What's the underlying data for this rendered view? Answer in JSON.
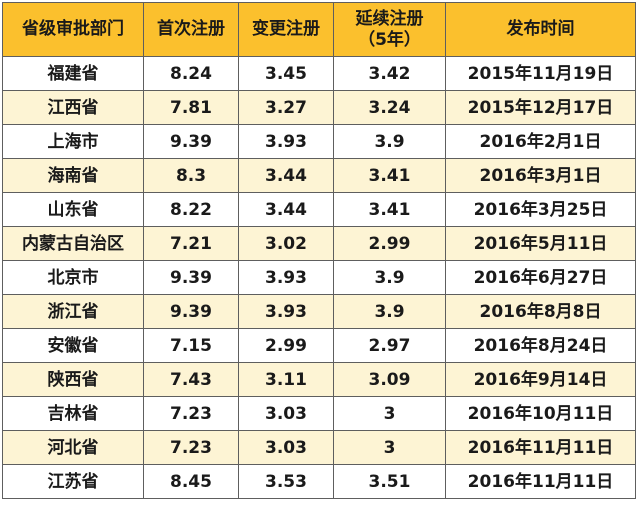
{
  "colors": {
    "header_bg": "#fbc02d",
    "odd_row_bg": "#ffffff",
    "even_row_bg": "#fdf4d4",
    "border": "#5e5e5e",
    "text": "#1a1a1a"
  },
  "header": {
    "dept": "省级审批部门",
    "first": "首次注册",
    "change": "变更注册",
    "renew_line1": "延续注册",
    "renew_line2": "（5年）",
    "date": "发布时间"
  },
  "rows": [
    {
      "dept": "福建省",
      "first": "8.24",
      "change": "3.45",
      "renew": "3.42",
      "date": "2015年11月19日"
    },
    {
      "dept": "江西省",
      "first": "7.81",
      "change": "3.27",
      "renew": "3.24",
      "date": "2015年12月17日"
    },
    {
      "dept": "上海市",
      "first": "9.39",
      "change": "3.93",
      "renew": "3.9",
      "date": "2016年2月1日"
    },
    {
      "dept": "海南省",
      "first": "8.3",
      "change": "3.44",
      "renew": "3.41",
      "date": "2016年3月1日"
    },
    {
      "dept": "山东省",
      "first": "8.22",
      "change": "3.44",
      "renew": "3.41",
      "date": "2016年3月25日"
    },
    {
      "dept": "内蒙古自治区",
      "first": "7.21",
      "change": "3.02",
      "renew": "2.99",
      "date": "2016年5月11日"
    },
    {
      "dept": "北京市",
      "first": "9.39",
      "change": "3.93",
      "renew": "3.9",
      "date": "2016年6月27日"
    },
    {
      "dept": "浙江省",
      "first": "9.39",
      "change": "3.93",
      "renew": "3.9",
      "date": "2016年8月8日"
    },
    {
      "dept": "安徽省",
      "first": "7.15",
      "change": "2.99",
      "renew": "2.97",
      "date": "2016年8月24日"
    },
    {
      "dept": "陕西省",
      "first": "7.43",
      "change": "3.11",
      "renew": "3.09",
      "date": "2016年9月14日"
    },
    {
      "dept": "吉林省",
      "first": "7.23",
      "change": "3.03",
      "renew": "3",
      "date": "2016年10月11日"
    },
    {
      "dept": "河北省",
      "first": "7.23",
      "change": "3.03",
      "renew": "3",
      "date": "2016年11月11日"
    },
    {
      "dept": "江苏省",
      "first": "8.45",
      "change": "3.53",
      "renew": "3.51",
      "date": "2016年11月11日"
    }
  ]
}
